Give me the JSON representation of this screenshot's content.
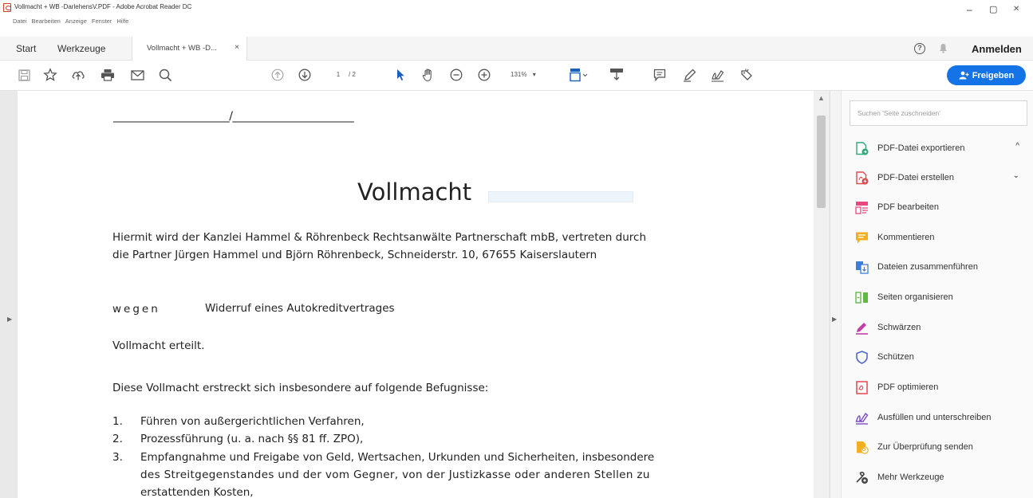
{
  "window": {
    "title": "Vollmacht + WB -DarlehensV.PDF - Adobe Acrobat Reader DC",
    "minimize": "–",
    "maximize": "▢",
    "close": "✕"
  },
  "menu": [
    "Datei",
    "Bearbeiten",
    "Anzeige",
    "Fenster",
    "Hilfe"
  ],
  "tabs": {
    "home": "Start",
    "tools": "Werkzeuge",
    "document": "Vollmacht + WB -D...",
    "close": "×"
  },
  "header_right": {
    "help": "?",
    "signin": "Anmelden"
  },
  "toolbar": {
    "page_current": "1",
    "page_total": "/ 2",
    "zoom": "131%",
    "zoom_caret": "▾",
    "share_label": "Freigeben"
  },
  "document": {
    "signature_line": "______________________/_______________________",
    "heading": "Vollmacht",
    "paragraph_line1": "Hiermit wird der Kanzlei Hammel & Röhrenbeck Rechtsanwälte Partnerschaft mbB, vertreten durch",
    "paragraph_line2": "die Partner Jürgen Hammel und Björn Röhrenbeck, Schneiderstr. 10, 67655 Kaiserslautern",
    "regarding_label": "wegen",
    "regarding_text": "Widerruf eines Autokreditvertrages",
    "granted": "Vollmacht erteilt.",
    "intro": "Diese Vollmacht erstreckt sich insbesondere auf folgende Befugnisse:",
    "list": [
      {
        "num": "1.",
        "text": "Führen von außergerichtlichen Verfahren,"
      },
      {
        "num": "2.",
        "text": "Prozessführung (u. a. nach §§ 81 ff. ZPO),"
      },
      {
        "num": "3.",
        "text": "Empfangnahme und Freigabe von Geld, Wertsachen,  Urkunden und Sicherheiten, insbesondere"
      }
    ],
    "list_item3_line2": "des Streitgegenstandes und der vom Gegner, von der Justizkasse oder anderen Stellen zu",
    "list_item3_line3": "erstattenden Kosten,"
  },
  "tools_pane": {
    "search_placeholder": "Suchen 'Seite zuschneiden'",
    "items": [
      {
        "label": "PDF-Datei exportieren",
        "icon": "export-pdf-icon",
        "color": "#2fa87a",
        "chevron": "^"
      },
      {
        "label": "PDF-Datei erstellen",
        "icon": "create-pdf-icon",
        "color": "#e34850",
        "chevron": "⌄"
      },
      {
        "label": "PDF bearbeiten",
        "icon": "edit-pdf-icon",
        "color": "#e8477f"
      },
      {
        "label": "Kommentieren",
        "icon": "comment-icon",
        "color": "#f2b020"
      },
      {
        "label": "Dateien zusammenführen",
        "icon": "combine-files-icon",
        "color": "#3d7fd6"
      },
      {
        "label": "Seiten organisieren",
        "icon": "organize-pages-icon",
        "color": "#62b847"
      },
      {
        "label": "Schwärzen",
        "icon": "redact-icon",
        "color": "#c23ea8"
      },
      {
        "label": "Schützen",
        "icon": "protect-icon",
        "color": "#4a64c9"
      },
      {
        "label": "PDF optimieren",
        "icon": "optimize-pdf-icon",
        "color": "#e34850"
      },
      {
        "label": "Ausfüllen und unterschreiben",
        "icon": "fill-sign-icon",
        "color": "#7b4cc9"
      },
      {
        "label": "Zur Überprüfung senden",
        "icon": "send-review-icon",
        "color": "#f2b020"
      },
      {
        "label": "Mehr Werkzeuge",
        "icon": "more-tools-icon",
        "color": "#444444"
      }
    ]
  }
}
